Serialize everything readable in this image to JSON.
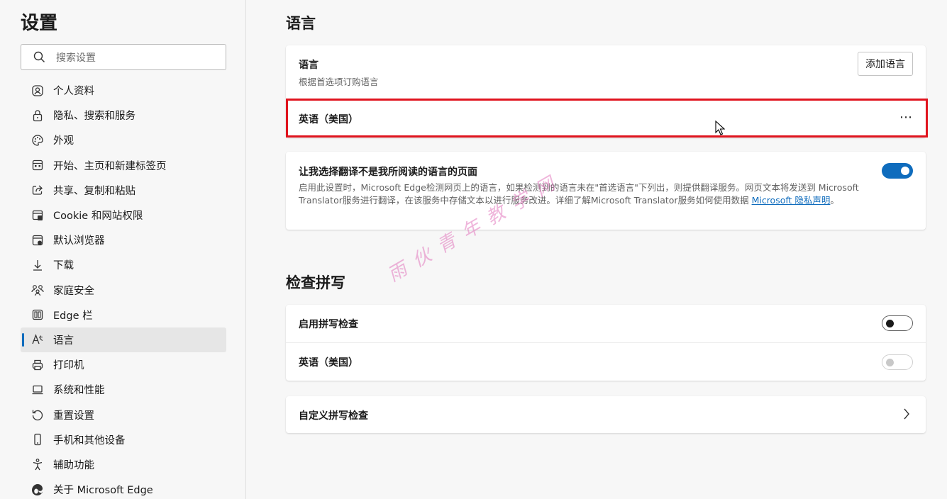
{
  "sidebar": {
    "title": "设置",
    "search_placeholder": "搜索设置",
    "items": [
      {
        "label": "个人资料",
        "icon": "profile-icon"
      },
      {
        "label": "隐私、搜索和服务",
        "icon": "lock-icon"
      },
      {
        "label": "外观",
        "icon": "palette-icon"
      },
      {
        "label": "开始、主页和新建标签页",
        "icon": "home-grid-icon"
      },
      {
        "label": "共享、复制和粘贴",
        "icon": "share-icon"
      },
      {
        "label": "Cookie 和网站权限",
        "icon": "site-permissions-icon"
      },
      {
        "label": "默认浏览器",
        "icon": "browser-icon"
      },
      {
        "label": "下载",
        "icon": "download-icon"
      },
      {
        "label": "家庭安全",
        "icon": "family-icon"
      },
      {
        "label": "Edge 栏",
        "icon": "edge-bar-icon"
      },
      {
        "label": "语言",
        "icon": "language-icon",
        "active": true
      },
      {
        "label": "打印机",
        "icon": "printer-icon"
      },
      {
        "label": "系统和性能",
        "icon": "laptop-icon"
      },
      {
        "label": "重置设置",
        "icon": "reset-icon"
      },
      {
        "label": "手机和其他设备",
        "icon": "phone-icon"
      },
      {
        "label": "辅助功能",
        "icon": "accessibility-icon"
      },
      {
        "label": "关于 Microsoft Edge",
        "icon": "edge-logo-icon"
      }
    ]
  },
  "language_section": {
    "heading": "语言",
    "languages_label": "语言",
    "languages_sub": "根据首选项订购语言",
    "add_button": "添加语言",
    "language_item": "英语（美国）",
    "translate_label": "让我选择翻译不是我所阅读的语言的页面",
    "translate_desc": "启用此设置时，Microsoft Edge检测网页上的语言，如果检测到的语言未在\"首选语言\"下列出，则提供翻译服务。网页文本将发送到 Microsoft Translator服务进行翻译，在该服务中存储文本以进行服务改进。详细了解Microsoft Translator服务如何使用数据",
    "translate_link": "Microsoft 隐私声明",
    "translate_desc_end": "。",
    "translate_enabled": true
  },
  "spellcheck_section": {
    "heading": "检查拼写",
    "enable_label": "启用拼写检查",
    "enable_on": false,
    "language_item": "英语（美国）",
    "custom_label": "自定义拼写检查"
  },
  "watermark": "雨伙青年教学网",
  "colors": {
    "accent": "#0f6cbd",
    "highlight": "#e0141e"
  }
}
